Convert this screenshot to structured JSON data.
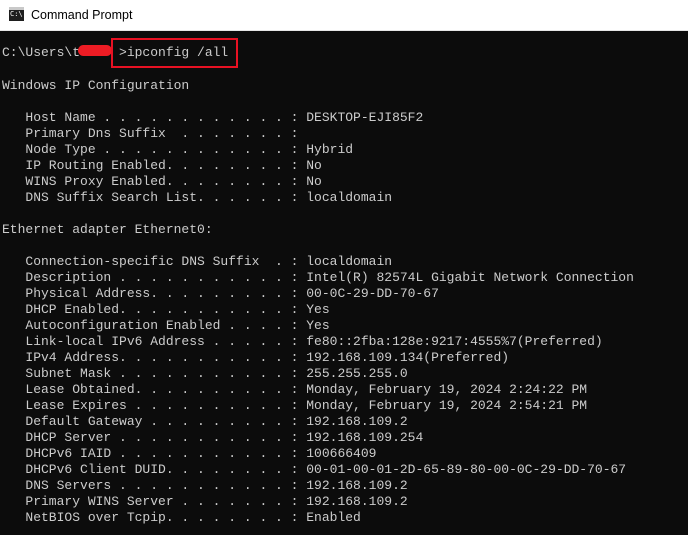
{
  "window": {
    "title": "Command Prompt",
    "icon": "cmd-icon",
    "icon_glyph": "C:\\"
  },
  "annotations": {
    "highlight_color": "#e81123",
    "redaction_color": "#ee1c24"
  },
  "console": {
    "lines": [
      "",
      "C:\\Users\\t     >ipconfig /all",
      "",
      "Windows IP Configuration",
      "",
      "   Host Name . . . . . . . . . . . . : DESKTOP-EJI85F2",
      "   Primary Dns Suffix  . . . . . . . :",
      "   Node Type . . . . . . . . . . . . : Hybrid",
      "   IP Routing Enabled. . . . . . . . : No",
      "   WINS Proxy Enabled. . . . . . . . : No",
      "   DNS Suffix Search List. . . . . . : localdomain",
      "",
      "Ethernet adapter Ethernet0:",
      "",
      "   Connection-specific DNS Suffix  . : localdomain",
      "   Description . . . . . . . . . . . : Intel(R) 82574L Gigabit Network Connection",
      "   Physical Address. . . . . . . . . : 00-0C-29-DD-70-67",
      "   DHCP Enabled. . . . . . . . . . . : Yes",
      "   Autoconfiguration Enabled . . . . : Yes",
      "   Link-local IPv6 Address . . . . . : fe80::2fba:128e:9217:4555%7(Preferred)",
      "   IPv4 Address. . . . . . . . . . . : 192.168.109.134(Preferred)",
      "   Subnet Mask . . . . . . . . . . . : 255.255.255.0",
      "   Lease Obtained. . . . . . . . . . : Monday, February 19, 2024 2:24:22 PM",
      "   Lease Expires . . . . . . . . . . : Monday, February 19, 2024 2:54:21 PM",
      "   Default Gateway . . . . . . . . . : 192.168.109.2",
      "   DHCP Server . . . . . . . . . . . : 192.168.109.254",
      "   DHCPv6 IAID . . . . . . . . . . . : 100666409",
      "   DHCPv6 Client DUID. . . . . . . . : 00-01-00-01-2D-65-89-80-00-0C-29-DD-70-67",
      "   DNS Servers . . . . . . . . . . . : 192.168.109.2",
      "   Primary WINS Server . . . . . . . : 192.168.109.2",
      "   NetBIOS over Tcpip. . . . . . . . : Enabled"
    ]
  }
}
